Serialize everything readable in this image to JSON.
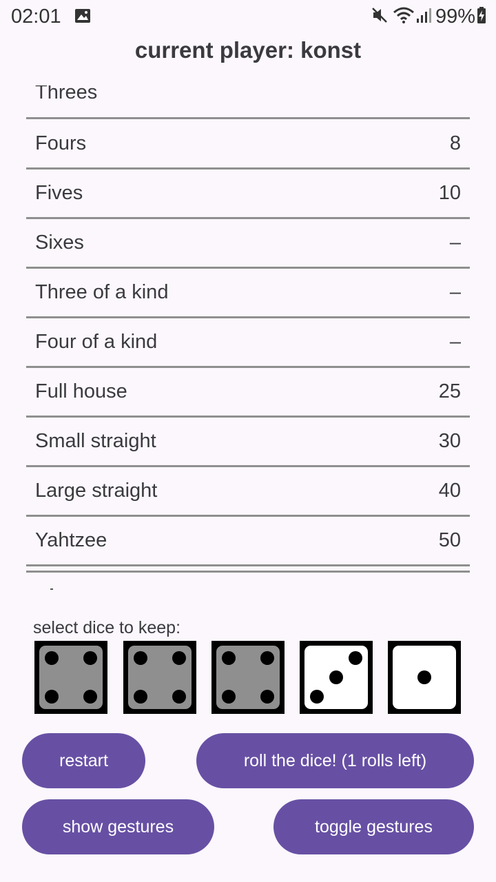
{
  "status": {
    "time": "02:01",
    "battery": "99%",
    "image_icon": "image-icon",
    "mute_icon": "mute-icon",
    "wifi_icon": "wifi-icon",
    "signal_icon": "signal-icon",
    "battery_icon": "battery-charging-icon"
  },
  "header": {
    "title": "current player: konst"
  },
  "scores": {
    "partial_top_label": "Threes",
    "rows": [
      {
        "label": "Fours",
        "value": "8"
      },
      {
        "label": "Fives",
        "value": "10"
      },
      {
        "label": "Sixes",
        "value": "–"
      },
      {
        "label": "Three of a kind",
        "value": "–"
      },
      {
        "label": "Four of a kind",
        "value": "–"
      },
      {
        "label": "Full house",
        "value": "25"
      },
      {
        "label": "Small straight",
        "value": "30"
      },
      {
        "label": "Large straight",
        "value": "40"
      },
      {
        "label": "Yahtzee",
        "value": "50"
      }
    ]
  },
  "dice": {
    "label": "select dice to keep:",
    "items": [
      {
        "value": 4,
        "kept": true
      },
      {
        "value": 4,
        "kept": true
      },
      {
        "value": 4,
        "kept": true
      },
      {
        "value": 3,
        "kept": false
      },
      {
        "value": 1,
        "kept": false
      }
    ],
    "colors": {
      "kept_face": "#8f8f8f",
      "free_face": "#ffffff"
    }
  },
  "buttons": {
    "restart": "restart",
    "roll": "roll the dice! (1 rolls left)",
    "show_gestures": "show gestures",
    "toggle_gestures": "toggle gestures"
  },
  "colors": {
    "accent": "#6750a4",
    "background": "#fcf7fd",
    "divider": "#8f8f8f"
  }
}
